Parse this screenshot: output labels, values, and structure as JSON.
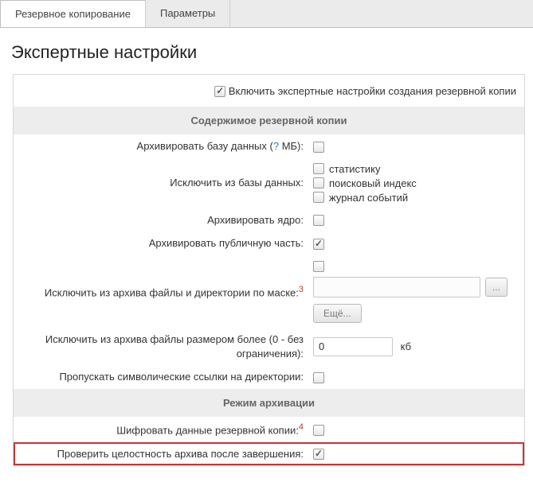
{
  "tabs": {
    "backup": "Резервное копирование",
    "params": "Параметры"
  },
  "page_title": "Экспертные настройки",
  "enable": {
    "label": "Включить экспертные настройки создания резервной копии",
    "checked": true
  },
  "sections": {
    "content_head": "Содержимое резервной копии",
    "mode_head": "Режим архивации"
  },
  "fields": {
    "archive_db_label_pre": "Архивировать базу данных (",
    "archive_db_q": "?",
    "archive_db_label_post": " МБ):",
    "archive_db_checked": false,
    "exclude_db_label": "Исключить из базы данных:",
    "exclude_db_opts": {
      "stat": {
        "label": "статистику",
        "checked": false
      },
      "search": {
        "label": "поисковый индекс",
        "checked": false
      },
      "log": {
        "label": "журнал событий",
        "checked": false
      }
    },
    "archive_core_label": "Архивировать ядро:",
    "archive_core_checked": false,
    "archive_public_label": "Архивировать публичную часть:",
    "archive_public_checked": true,
    "exclude_mask_label": "Исключить из архива файлы и директории по маске:",
    "exclude_mask_sup": "3",
    "exclude_mask_checked": false,
    "exclude_mask_value": "",
    "exclude_mask_browse": "...",
    "exclude_mask_more": "Ещё...",
    "exclude_size_label": "Исключить из архива файлы размером более (0 - без ограничения):",
    "exclude_size_value": "0",
    "exclude_size_unit": "кб",
    "skip_symlinks_label": "Пропускать символические ссылки на директории:",
    "skip_symlinks_checked": false,
    "encrypt_label": "Шифровать данные резервной копии:",
    "encrypt_sup": "4",
    "encrypt_checked": false,
    "verify_label": "Проверить целостность архива после завершения:",
    "verify_checked": true
  }
}
